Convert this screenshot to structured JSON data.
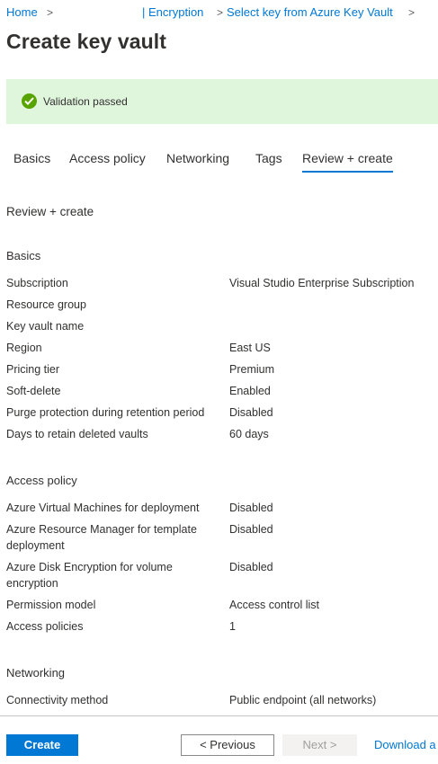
{
  "breadcrumb": {
    "items": [
      "Home",
      "| Encryption",
      "Select key from Azure Key Vault"
    ],
    "separator": ">"
  },
  "page": {
    "title": "Create key vault"
  },
  "banner": {
    "text": "Validation passed",
    "icon": "check-circle-icon",
    "color": "#57a300",
    "background": "#dff6dd"
  },
  "tabs": [
    {
      "label": "Basics"
    },
    {
      "label": "Access policy"
    },
    {
      "label": "Networking"
    },
    {
      "label": "Tags"
    },
    {
      "label": "Review + create",
      "active": true
    }
  ],
  "review": {
    "heading": "Review + create",
    "basics": {
      "heading": "Basics",
      "rows": [
        {
          "label": "Subscription",
          "value": "Visual Studio Enterprise Subscription"
        },
        {
          "label": "Resource group",
          "value": ""
        },
        {
          "label": "Key vault name",
          "value": ""
        },
        {
          "label": "Region",
          "value": "East US"
        },
        {
          "label": "Pricing tier",
          "value": "Premium"
        },
        {
          "label": "Soft-delete",
          "value": "Enabled"
        },
        {
          "label": "Purge protection during retention period",
          "value": "Disabled"
        },
        {
          "label": "Days to retain deleted vaults",
          "value": "60 days"
        }
      ]
    },
    "access_policy": {
      "heading": "Access policy",
      "rows": [
        {
          "label": "Azure Virtual Machines for deployment",
          "value": "Disabled"
        },
        {
          "label": "Azure Resource Manager for template deployment",
          "value": "Disabled"
        },
        {
          "label": "Azure Disk Encryption for volume encryption",
          "value": "Disabled"
        },
        {
          "label": "Permission model",
          "value": "Access control list"
        },
        {
          "label": "Access policies",
          "value": "1"
        }
      ]
    },
    "networking": {
      "heading": "Networking",
      "rows": [
        {
          "label": "Connectivity method",
          "value": "Public endpoint (all networks)"
        }
      ]
    }
  },
  "footer": {
    "create_label": "Create",
    "previous_label": "< Previous",
    "next_label": "Next >",
    "download_label": "Download a"
  },
  "colors": {
    "accent": "#0078d4",
    "text": "#323130",
    "success": "#57a300"
  }
}
